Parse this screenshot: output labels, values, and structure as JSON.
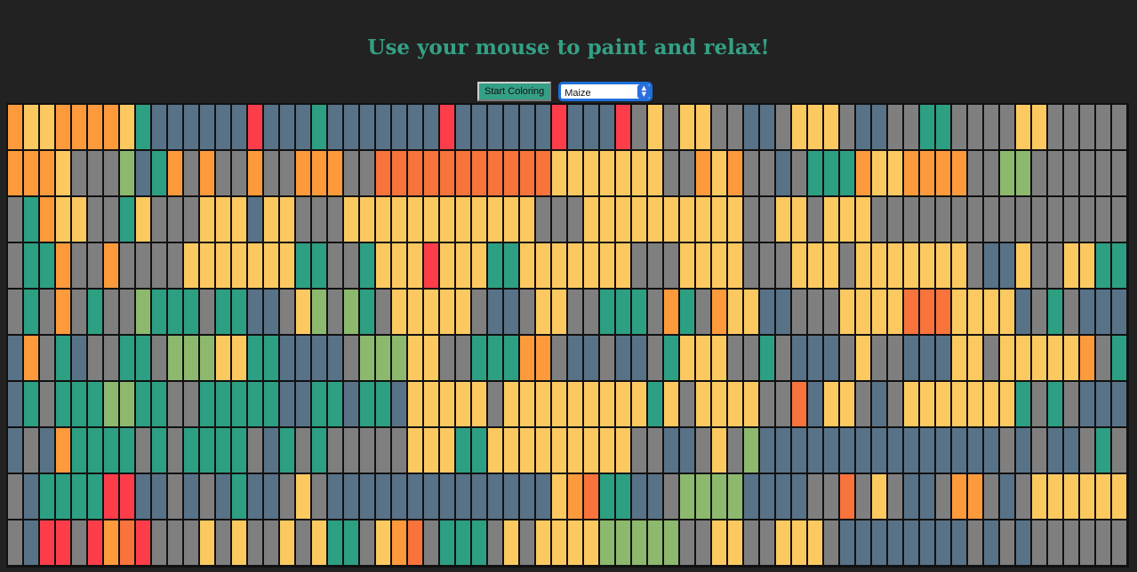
{
  "title": "Use your mouse to paint and relax!",
  "controls": {
    "start_label": "Start Coloring",
    "selected_color": "Maize"
  },
  "icons": {
    "select_arrows": "up-down-chevron-icon"
  },
  "palette": {
    "g": "#7f7f7f",
    "y": "#fcc961",
    "o": "#fd9a3c",
    "r": "#fe3d4a",
    "t": "#2d9f82",
    "b": "#587287",
    "l": "#8cb96d",
    "s": "#f9733d"
  },
  "grid": {
    "columns": 70,
    "rows": [
      "oyyooooytbbbbbbrbbbtbbbbbbbrbbbbbbrbbbrgygyyggbbgyyygbbggttggggyygggggggllg",
      "oooyggglbtogoggoggoooggsssssssssssyyyyyyyggoyoggbgtttoyyooooggll",
      "gtoyyggtygggyyybyygggyyyyyyyyyyyygggyyyyyyyyyyggyygyyygg",
      "gttoggoggggyyyyyyyttggtyyyryyyttyyyyyyygggyyyygggyyygyyyyyyygbbyggyyttgrrgl",
      "gtgogtggltttgttbbgylgltgyyyyygbbgyyggtttgotgoyybbgggyyyysssyyyybgtgbbbggbtsgsgl",
      "bogtbggttglllyyttbbbbglllyyggtttoogbbgbbgtyyyggtgbbbgyggbbbyygyyyyyogtgbgbgyygrgl",
      "btgtttllttggtttttbbttbttbyyyyygyyyyyyyyytygyyyyggsbyygbgyyyyyyytgtgbbbtggyyybgbrgl",
      "bgbottttgtgttttgbtgtgggggyyyttyyyyyyyyyggbbgyglbbbbbbbbbbbbbbbgbgbbgtgbtbgtbbgggggsggyyybgg",
      "gbttttrrbbgbgbtbbgygbbbbbbbbbbbbbbyosttbbgllllbbbbggsgygbbgoogbgyyyyyyyyyygg",
      "gbrrgrosrgggygyggygyttgyosgtttgygyyyylllllggyyggyyygbbbbbbbbgbgbgg"
    ]
  }
}
